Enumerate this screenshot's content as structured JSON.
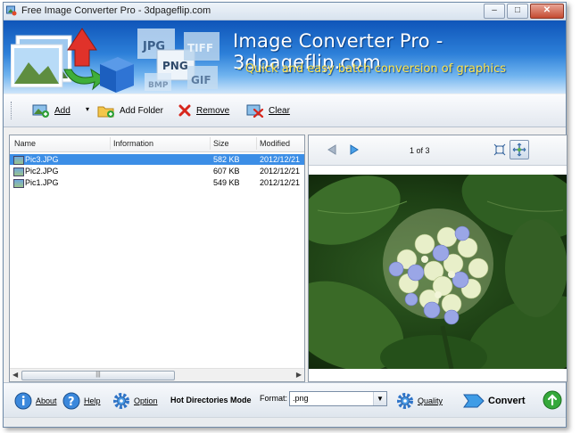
{
  "window": {
    "title": "Free Image Converter Pro - 3dpageflip.com",
    "controls": {
      "minimize": "–",
      "maximize": "□",
      "close": "✕"
    }
  },
  "banner": {
    "title": "Image Converter Pro - 3dpageflip.com",
    "subtitle": "- Quick and easy batch conversion of graphics",
    "format_badges": [
      "JPG",
      "PNG",
      "TIFF",
      "BMP",
      "GIF"
    ]
  },
  "toolbar": {
    "add_label": "Add",
    "add_dropdown": "▾",
    "add_folder_label": "Add Folder",
    "remove_label": "Remove",
    "clear_label": "Clear"
  },
  "file_list": {
    "columns": [
      "Name",
      "Information",
      "Size",
      "Modified"
    ],
    "rows": [
      {
        "name": "Pic3.JPG",
        "information": "",
        "size": "582 KB",
        "modified": "2012/12/21",
        "selected": true
      },
      {
        "name": "Pic2.JPG",
        "information": "",
        "size": "607 KB",
        "modified": "2012/12/21",
        "selected": false
      },
      {
        "name": "Pic1.JPG",
        "information": "",
        "size": "549 KB",
        "modified": "2012/12/21",
        "selected": false
      }
    ],
    "scroll": {
      "left": "◀",
      "right": "▶",
      "grip": "|||"
    }
  },
  "viewer": {
    "page_info": "1 of 3",
    "image_description": "hydrangea"
  },
  "bottom": {
    "about_label": "About",
    "help_label": "Help",
    "option_label": "Option",
    "hot_directories_label": "Hot Directories Mode",
    "format_label": "Format:",
    "format_value": ".png",
    "quality_label": "Quality",
    "convert_label": "Convert"
  },
  "colors": {
    "selection": "#3c8ee6",
    "banner_top": "#0f55b9",
    "subtitle": "#ffe34a"
  }
}
